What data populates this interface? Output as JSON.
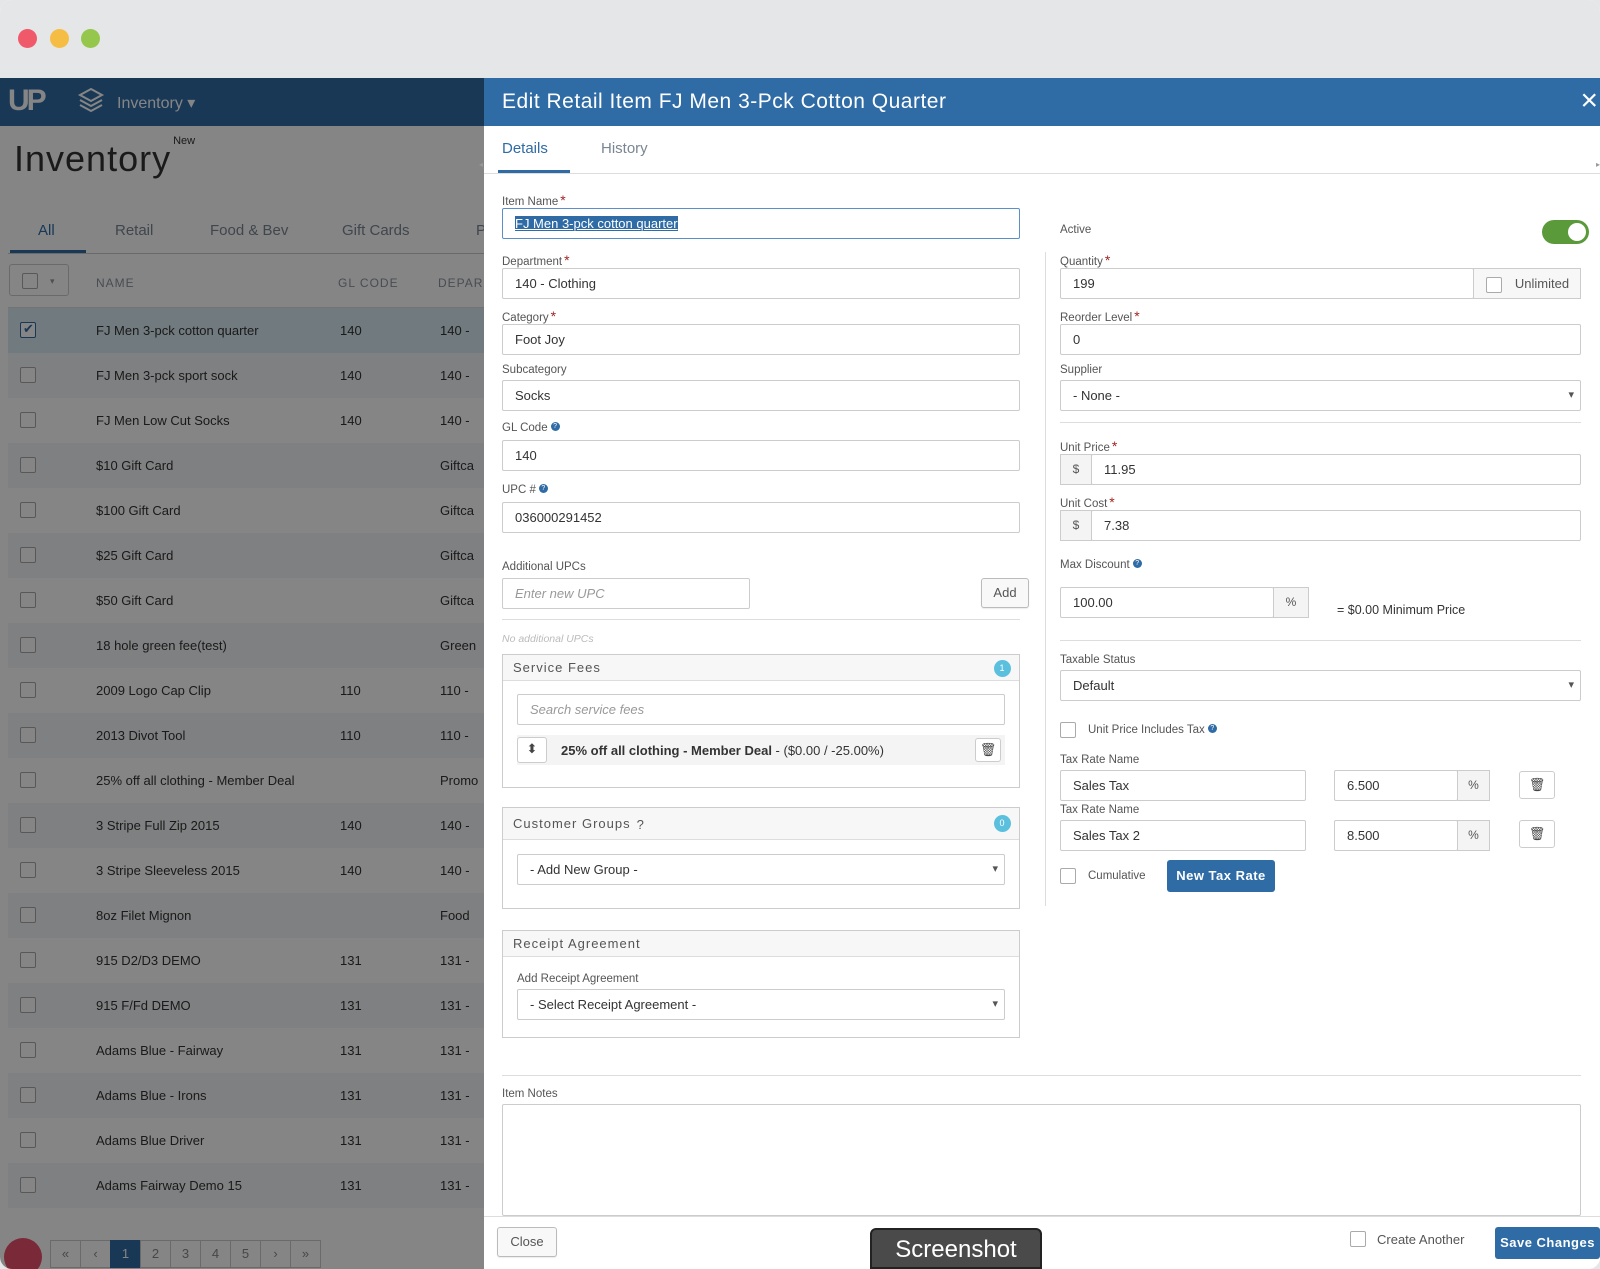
{
  "nav": {
    "logo": "UP",
    "module": "Inventory ▾"
  },
  "page": {
    "title": "Inventory",
    "title_badge": "New"
  },
  "list_tabs": [
    "All",
    "Retail",
    "Food & Bev",
    "Gift Cards",
    "P"
  ],
  "table": {
    "columns": [
      "NAME",
      "GL CODE",
      "DEPAR"
    ],
    "rows": [
      {
        "name": "FJ Men 3-pck cotton quarter",
        "gl": "140",
        "dept": "140 -",
        "checked": true
      },
      {
        "name": "FJ Men 3-pck sport sock",
        "gl": "140",
        "dept": "140 -"
      },
      {
        "name": "FJ Men Low Cut Socks",
        "gl": "140",
        "dept": "140 -"
      },
      {
        "name": "$10 Gift Card",
        "gl": "",
        "dept": "Giftca"
      },
      {
        "name": "$100 Gift Card",
        "gl": "",
        "dept": "Giftca"
      },
      {
        "name": "$25 Gift Card",
        "gl": "",
        "dept": "Giftca"
      },
      {
        "name": "$50 Gift Card",
        "gl": "",
        "dept": "Giftca"
      },
      {
        "name": "18 hole green fee(test)",
        "gl": "",
        "dept": "Green"
      },
      {
        "name": "2009 Logo Cap Clip",
        "gl": "110",
        "dept": "110 -"
      },
      {
        "name": "2013 Divot Tool",
        "gl": "110",
        "dept": "110 -"
      },
      {
        "name": "25% off all clothing - Member Deal",
        "gl": "",
        "dept": "Promo"
      },
      {
        "name": "3 Stripe Full Zip 2015",
        "gl": "140",
        "dept": "140 -"
      },
      {
        "name": "3 Stripe Sleeveless 2015",
        "gl": "140",
        "dept": "140 -"
      },
      {
        "name": "8oz Filet Mignon",
        "gl": "",
        "dept": "Food"
      },
      {
        "name": "915 D2/D3 DEMO",
        "gl": "131",
        "dept": "131 -"
      },
      {
        "name": "915 F/Fd DEMO",
        "gl": "131",
        "dept": "131 -"
      },
      {
        "name": "Adams Blue - Fairway",
        "gl": "131",
        "dept": "131 -"
      },
      {
        "name": "Adams Blue - Irons",
        "gl": "131",
        "dept": "131 -"
      },
      {
        "name": "Adams Blue Driver",
        "gl": "131",
        "dept": "131 -"
      },
      {
        "name": "Adams Fairway Demo 15",
        "gl": "131",
        "dept": "131 -"
      }
    ]
  },
  "pager": [
    "«",
    "‹",
    "1",
    "2",
    "3",
    "4",
    "5",
    "›",
    "»"
  ],
  "modal": {
    "title": "Edit Retail Item FJ Men 3-Pck Cotton Quarter",
    "close_icon": "×",
    "tabs": [
      "Details",
      "History"
    ],
    "labels": {
      "item_name": "Item Name",
      "department": "Department",
      "category": "Category",
      "subcategory": "Subcategory",
      "gl_code": "GL Code",
      "upc": "UPC #",
      "additional_upcs": "Additional UPCs",
      "active": "Active",
      "quantity": "Quantity",
      "reorder": "Reorder Level",
      "supplier": "Supplier",
      "unit_price": "Unit Price",
      "unit_cost": "Unit Cost",
      "max_discount": "Max Discount",
      "taxable": "Taxable Status",
      "price_includes_tax": "Unit Price Includes Tax",
      "tax_rate_name": "Tax Rate Name",
      "cumulative": "Cumulative",
      "item_notes": "Item Notes",
      "add_receipt": "Add Receipt Agreement"
    },
    "values": {
      "item_name": "FJ Men 3-pck cotton quarter",
      "department": "140 - Clothing",
      "category": "Foot Joy",
      "subcategory": "Socks",
      "gl_code": "140",
      "upc": "036000291452",
      "quantity": "199",
      "reorder": "0",
      "supplier": "- None -",
      "unit_price": "11.95",
      "unit_cost": "7.38",
      "max_discount": "100.00",
      "min_price": "= $0.00 Minimum Price",
      "taxable": "Default",
      "tax1_name": "Sales Tax",
      "tax1_rate": "6.500",
      "tax2_name": "Sales Tax 2",
      "tax2_rate": "8.500"
    },
    "placeholders": {
      "new_upc": "Enter new UPC",
      "search_fees": "Search service fees"
    },
    "no_upcs": "No additional UPCs",
    "unlimited": "Unlimited",
    "currency": "$",
    "percent": "%",
    "buttons": {
      "add": "Add",
      "new_tax_rate": "New Tax Rate",
      "close": "Close",
      "save": "Save Changes"
    },
    "create_another": "Create Another",
    "service_fees": {
      "title": "Service Fees",
      "count": "1",
      "fee_name": "25% off all clothing - Member Deal",
      "fee_detail": " - ($0.00 / -25.00%)"
    },
    "customer_groups": {
      "title": "Customer Groups",
      "count": "0",
      "select": "- Add New Group -"
    },
    "receipt_agreement": {
      "title": "Receipt Agreement",
      "select": "- Select Receipt Agreement -"
    }
  },
  "tooltip": "Screenshot",
  "colors": {
    "primary": "#2f6ba5",
    "toggle_on": "#5a9a3a",
    "badge": "#5bc0de"
  }
}
